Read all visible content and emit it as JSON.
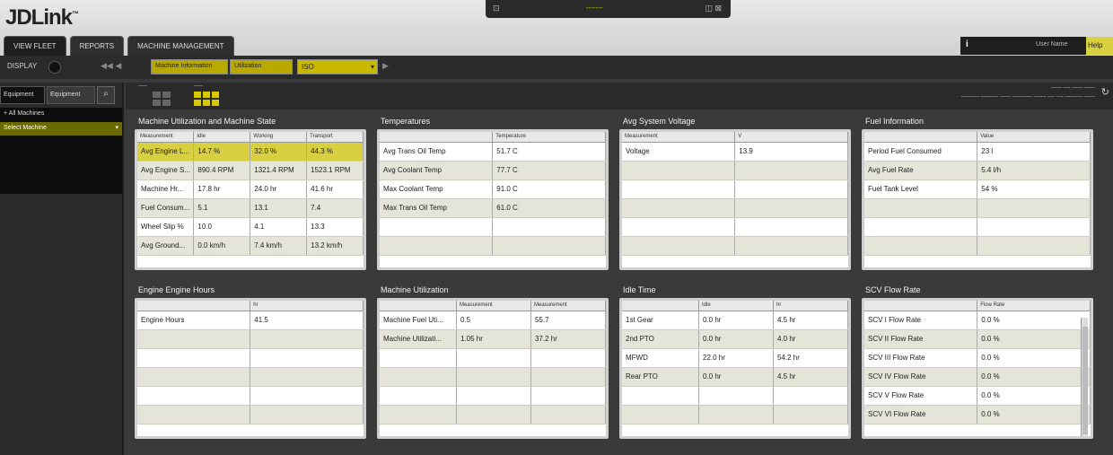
{
  "app": {
    "logo": "JDLink",
    "logo_mark": "™",
    "top_center": "-------",
    "top_left_icon": "⊡",
    "top_right_icon": "◫ ⊠"
  },
  "tabs": [
    "VIEW FLEET",
    "REPORTS",
    "MACHINE MANAGEMENT"
  ],
  "user": {
    "info_icon": "i",
    "text": "User Name",
    "accent": "Help"
  },
  "filter": {
    "label": "DISPLAY",
    "arrows": "◀◀ ◀",
    "chip1": "Machine Information",
    "chip2": "Utilization",
    "select_value": "ISO",
    "right_arrow": "▶"
  },
  "sidebar": {
    "btn1": "Equipment",
    "btn2": "Equipment",
    "search": "⌕",
    "item1": "+ All Machines",
    "item2": "Select Machine"
  },
  "viewbar": {
    "label_left": "-----",
    "label_right": "-----",
    "right_line1": "------ ---- ------ ------",
    "right_line2": "---------- ---------- ------ ----------- ------- ---- ---- ---------- ------",
    "refresh_icon": "↻"
  },
  "colors": {
    "accent": "#d8d040",
    "panel_bg": "#ffffff",
    "row_alt": "#e4e4d8",
    "page_bg": "#3a3a3a"
  },
  "panels": [
    {
      "title": "Machine Utilization and Machine State",
      "columns": [
        "Measurement",
        "Idle",
        "Working",
        "Transport"
      ],
      "rows": [
        [
          "Avg Engine L...",
          "14.7 %",
          "32.0 %",
          "44.3 %"
        ],
        [
          "Avg Engine S...",
          "890.4 RPM",
          "1321.4 RPM",
          "1523.1 RPM"
        ],
        [
          "Machine Hr...",
          "17.8 hr",
          "24.0 hr",
          "41.6 hr"
        ],
        [
          "Fuel Consum...",
          "5.1",
          "13.1",
          "7.4"
        ],
        [
          "Wheel Slip %",
          "10.0",
          "4.1",
          "13.3"
        ],
        [
          "Avg Ground...",
          "0.0 km/h",
          "7.4 km/h",
          "13.2 km/h"
        ]
      ],
      "selected_row": 0
    },
    {
      "title": "Temperatures",
      "columns": [
        "",
        "Temperature"
      ],
      "rows": [
        [
          "Avg Trans Oil Temp",
          "51.7 C"
        ],
        [
          "Avg Coolant Temp",
          "77.7 C"
        ],
        [
          "Max Coolant Temp",
          "91.0 C"
        ],
        [
          "Max Trans Oil Temp",
          "61.0 C"
        ]
      ]
    },
    {
      "title": "Avg System Voltage",
      "columns": [
        "Measurement",
        "V"
      ],
      "rows": [
        [
          "Voltage",
          "13.9"
        ]
      ]
    },
    {
      "title": "Fuel Information",
      "columns": [
        "",
        "Value"
      ],
      "rows": [
        [
          "Period Fuel Consumed",
          "23 l"
        ],
        [
          "Avg Fuel Rate",
          "5.4 l/h"
        ],
        [
          "Fuel Tank Level",
          "54 %"
        ]
      ]
    },
    {
      "title": "Engine Engine Hours",
      "columns": [
        "",
        "hr"
      ],
      "rows": [
        [
          "Engine Hours",
          "41.5"
        ]
      ]
    },
    {
      "title": "Machine Utilization",
      "columns": [
        "",
        "Measurement",
        "Measurement"
      ],
      "rows": [
        [
          "Machine Fuel Uti...",
          "0.5",
          "55.7"
        ],
        [
          "Machine Utilizati...",
          "1.05 hr",
          "37.2 hr"
        ]
      ]
    },
    {
      "title": "Idle Time",
      "columns": [
        "",
        "Idle",
        "hr"
      ],
      "rows": [
        [
          "1st Gear",
          "0.0 hr",
          "4.5 hr"
        ],
        [
          "2nd PTO",
          "0.0 hr",
          "4.0 hr"
        ],
        [
          "MFWD",
          "22.0 hr",
          "54.2 hr"
        ],
        [
          "Rear PTO",
          "0.0 hr",
          "4.5 hr"
        ]
      ]
    },
    {
      "title": "SCV Flow Rate",
      "columns": [
        "",
        "Flow Rate"
      ],
      "rows": [
        [
          "SCV I Flow Rate",
          "0.0 %"
        ],
        [
          "SCV II Flow Rate",
          "0.0 %"
        ],
        [
          "SCV III Flow Rate",
          "0.0 %"
        ],
        [
          "SCV IV Flow Rate",
          "0.0 %"
        ],
        [
          "SCV V Flow Rate",
          "0.0 %"
        ],
        [
          "SCV VI Flow Rate",
          "0.0 %"
        ]
      ]
    }
  ]
}
